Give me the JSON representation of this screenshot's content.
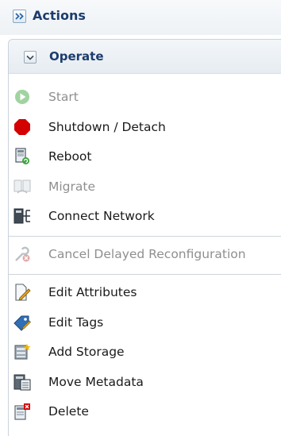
{
  "actions": {
    "title": "Actions",
    "toggle_icon": "double-chevron-right-icon"
  },
  "operate": {
    "title": "Operate",
    "toggle_icon": "chevron-down-icon",
    "items": [
      {
        "label": "Start",
        "icon": "play-icon",
        "enabled": false
      },
      {
        "label": "Shutdown / Detach",
        "icon": "stop-octagon-icon",
        "enabled": true
      },
      {
        "label": "Reboot",
        "icon": "reboot-icon",
        "enabled": true
      },
      {
        "label": "Migrate",
        "icon": "migrate-icon",
        "enabled": false
      },
      {
        "label": "Connect Network",
        "icon": "network-icon",
        "enabled": true
      },
      {
        "label": "Cancel Delayed Reconfiguration",
        "icon": "cancel-reconfig-icon",
        "enabled": false
      },
      {
        "label": "Edit Attributes",
        "icon": "edit-attributes-icon",
        "enabled": true
      },
      {
        "label": "Edit Tags",
        "icon": "tag-icon",
        "enabled": true
      },
      {
        "label": "Add Storage",
        "icon": "storage-icon",
        "enabled": true
      },
      {
        "label": "Move Metadata",
        "icon": "metadata-icon",
        "enabled": true
      },
      {
        "label": "Delete",
        "icon": "delete-icon",
        "enabled": true
      }
    ]
  },
  "colors": {
    "header_text": "#1c3c6e",
    "disabled_text": "#8f8f8f",
    "stop_red": "#d40000",
    "start_green": "#2f9e2f"
  }
}
